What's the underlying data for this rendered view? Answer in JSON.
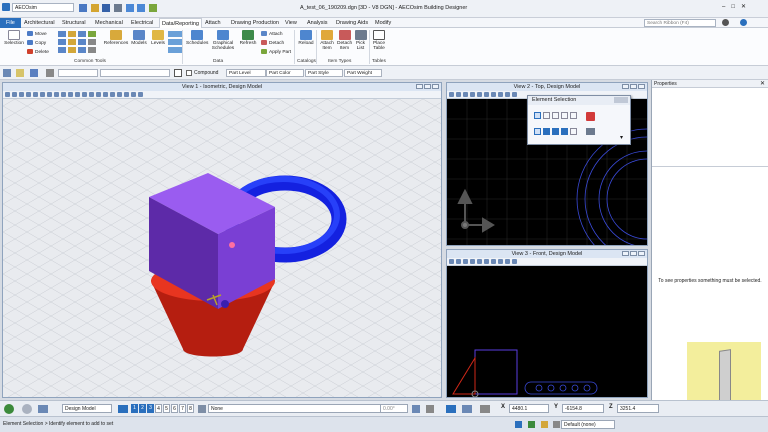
{
  "title_bar": {
    "workspace": "AECOsim",
    "title": "A_test_06_190209.dgn [3D - V8 DGN] - AECOsim Building Designer",
    "search_placeholder": "Search Ribbon (F4)"
  },
  "ribbon_tabs": [
    "File",
    "Architectural",
    "Structural",
    "Mechanical",
    "Electrical",
    "Data/Reporting",
    "Attach",
    "Drawing Production",
    "View",
    "Analysis",
    "Drawing Aids",
    "Modify"
  ],
  "active_tab": "Data/Reporting",
  "ribbon": {
    "selection": "Selection",
    "move": "Move",
    "copy": "Copy",
    "delete": "Delete",
    "references": "References",
    "models": "Models",
    "levels": "Levels",
    "common_tools": "Common Tools",
    "schedules": "Schedules",
    "graphical_schedules": "Graphical Schedules",
    "refresh": "Refresh",
    "attach": "Attach",
    "detach": "Detach",
    "apply_part": "Apply Part",
    "data": "Data",
    "reload": "Reload",
    "catalogs": "Catalogs",
    "attach_item": "Attach Item",
    "detach_item": "Detach Item",
    "pick_list": "Pick List",
    "item_types": "Item Types",
    "place_table": "Place Table",
    "tables": "Tables"
  },
  "attributes": {
    "compound": "Compound",
    "part_level": "Part Level",
    "part_color": "Part Color",
    "part_style": "Part Style",
    "part_weight": "Part Weight"
  },
  "views": {
    "v1": "View 1 - Isometric, Design Model",
    "v2": "View 2 - Top, Design Model",
    "v3": "View 3 - Front, Design Model"
  },
  "element_selection": {
    "title": "Element Selection"
  },
  "properties": {
    "title": "Properties",
    "empty_message": "To see properties something must be selected."
  },
  "status": {
    "model": "Design Model",
    "views": [
      "1",
      "2",
      "3",
      "4",
      "5",
      "6",
      "7",
      "8"
    ],
    "level": "None",
    "angle": "0.00°",
    "x_label": "X",
    "x_value": "4480.1",
    "y_label": "Y",
    "y_value": "-6154.8",
    "z_label": "Z",
    "z_value": "3251.4"
  },
  "prompt": {
    "message": "Element Selection > Identify element to add to set",
    "default": "Default (none)"
  },
  "colors": {
    "accent": "#2a6fbd",
    "box": "#7b3fd0",
    "torus": "#1a2ee8",
    "cone": "#e8321e",
    "view_bg": "#000000"
  }
}
